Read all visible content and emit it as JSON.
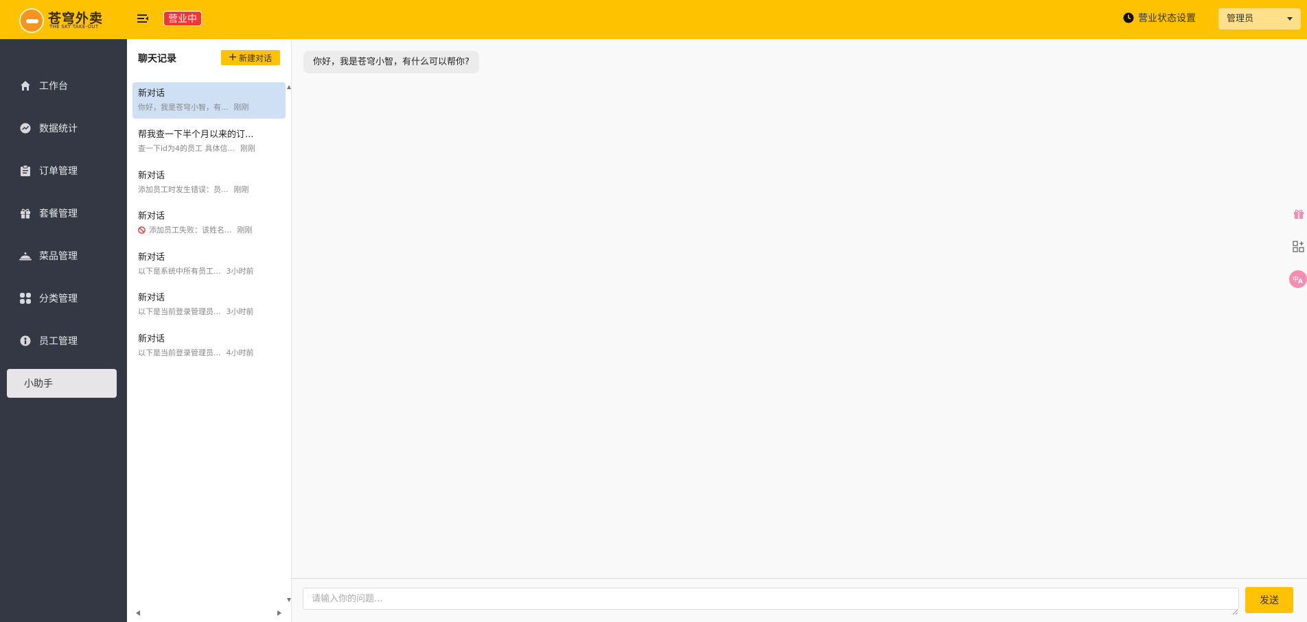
{
  "header": {
    "logo_cn": "苍穹外卖",
    "logo_en": "THE SKY TAKE-OUT",
    "status_badge": "营业中",
    "biz_setting_label": "营业状态设置",
    "admin_label": "管理员",
    "accent_color": "#ffc200"
  },
  "sidebar": {
    "items": [
      {
        "label": "工作台",
        "icon": "home-icon"
      },
      {
        "label": "数据统计",
        "icon": "chart-icon"
      },
      {
        "label": "订单管理",
        "icon": "clipboard-icon"
      },
      {
        "label": "套餐管理",
        "icon": "gift-icon"
      },
      {
        "label": "菜品管理",
        "icon": "cloche-icon"
      },
      {
        "label": "分类管理",
        "icon": "grid-icon"
      },
      {
        "label": "员工管理",
        "icon": "person-icon"
      },
      {
        "label": "小助手",
        "icon": "",
        "active": true
      }
    ]
  },
  "chat_list": {
    "title": "聊天记录",
    "new_chat_label": "新建对话",
    "sessions": [
      {
        "title": "新对话",
        "preview": "你好，我是苍穹小智，有...",
        "time": "刚刚",
        "active": true
      },
      {
        "title": "帮我查一下半个月以来的订...",
        "preview": "查一下id为4的员工 具体信...",
        "time": "刚刚"
      },
      {
        "title": "新对话",
        "preview": "添加员工时发生错误：员...",
        "time": "刚刚"
      },
      {
        "title": "新对话",
        "preview": "添加员工失败：该姓名...",
        "time": "刚刚",
        "error_icon": true
      },
      {
        "title": "新对话",
        "preview": "以下是系统中所有员工...",
        "time": "3小时前"
      },
      {
        "title": "新对话",
        "preview": "以下是当前登录管理员...",
        "time": "3小时前"
      },
      {
        "title": "新对话",
        "preview": "以下是当前登录管理员...",
        "time": "4小时前"
      }
    ]
  },
  "chat": {
    "messages": [
      {
        "role": "assistant",
        "text": "你好，我是苍穹小智，有什么可以帮你?"
      }
    ]
  },
  "input": {
    "placeholder": "请输入你的问题...",
    "value": "",
    "send_label": "发送"
  }
}
